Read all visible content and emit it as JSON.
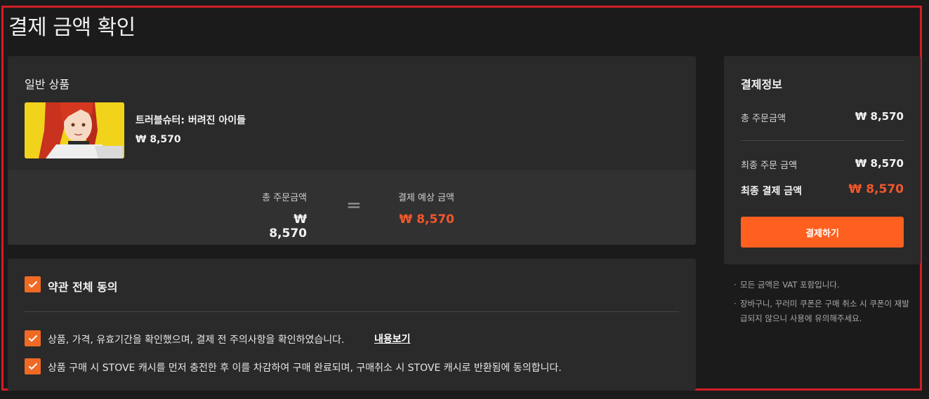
{
  "page": {
    "title": "결제 금액 확인"
  },
  "product_section": {
    "title": "일반 상품",
    "product": {
      "name": "트러블슈터: 버려진 아이들",
      "price": "₩ 8,570"
    },
    "summary": {
      "total_label": "총 주문금액",
      "total_value": "₩ 8,570",
      "equals": "=",
      "expected_label": "결제 예상 금액",
      "expected_value": "₩ 8,570"
    }
  },
  "terms": {
    "agree_all_label": "약관 전체 동의",
    "items": [
      {
        "text": "상품, 가격, 유효기간을 확인했으며, 결제 전 주의사항을 확인하였습니다.",
        "link": "내용보기"
      },
      {
        "text": "상품 구매 시 STOVE 캐시를 먼저 충전한 후 이를 차감하여 구매 완료되며, 구매취소 시 STOVE 캐시로 반환됨에 동의합니다."
      }
    ]
  },
  "payment_info": {
    "title": "결제정보",
    "total_order_label": "총 주문금액",
    "total_order_value": "₩ 8,570",
    "final_order_label": "최종 주문 금액",
    "final_order_value": "₩ 8,570",
    "final_pay_label": "최종 결제 금액",
    "final_pay_value": "₩ 8,570",
    "pay_button": "결제하기"
  },
  "notes": [
    "모든 금액은 VAT 포함입니다.",
    "장바구니, 꾸러미 쿠폰은 구매 취소 시 쿠폰이 재발급되지 않으니 사용에 유의해주세요."
  ],
  "colors": {
    "accent": "#ff5f1f",
    "price_highlight": "#f2572b",
    "frame": "#d01f26"
  }
}
